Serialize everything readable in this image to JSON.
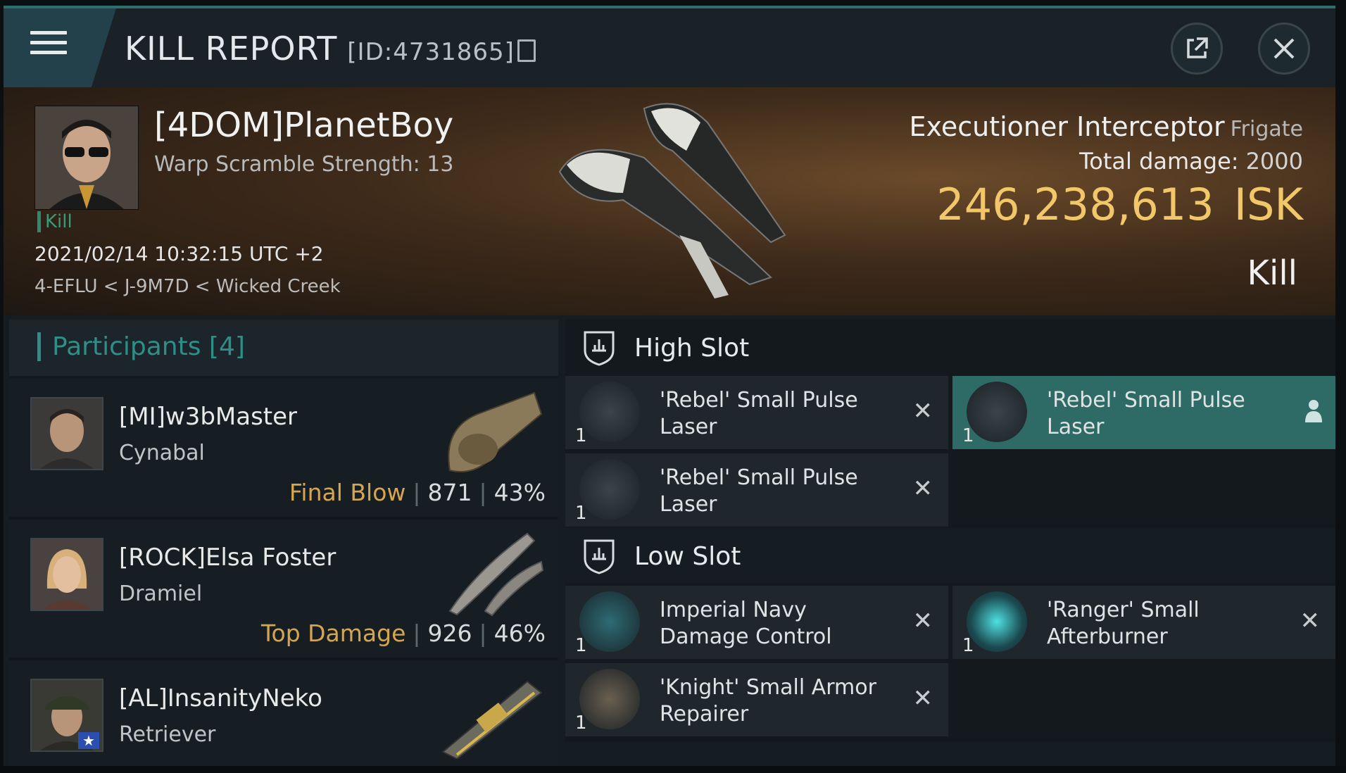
{
  "header": {
    "title": "KILL REPORT",
    "id_label": "[ID:4731865]"
  },
  "victim": {
    "name": "[4DOM]PlanetBoy",
    "warp_scramble": "Warp Scramble Strength: 13",
    "tag": "Kill",
    "datetime": "2021/02/14 10:32:15 UTC +2",
    "location": "4-EFLU < J-9M7D < Wicked Creek"
  },
  "ship": {
    "name": "Executioner Interceptor",
    "class": "Frigate",
    "total_damage_label": "Total damage:",
    "total_damage": "2000",
    "isk_value": "246,238,613",
    "isk_unit": "ISK",
    "result": "Kill"
  },
  "participants": {
    "title": "Participants [4]",
    "rows": [
      {
        "name": "[MI]w3bMaster",
        "ship": "Cynabal",
        "role": "Final Blow",
        "damage": "871",
        "percent": "43%"
      },
      {
        "name": "[ROCK]Elsa Foster",
        "ship": "Dramiel",
        "role": "Top Damage",
        "damage": "926",
        "percent": "46%"
      },
      {
        "name": "[AL]InsanityNeko",
        "ship": "Retriever",
        "role": "",
        "damage": "",
        "percent": ""
      }
    ]
  },
  "fitting": {
    "high_slot": {
      "title": "High Slot",
      "modules": [
        {
          "qty": "1",
          "name": "'Rebel' Small Pulse Laser",
          "state": "destroyed"
        },
        {
          "qty": "1",
          "name": "'Rebel' Small Pulse Laser",
          "state": "dropped"
        },
        {
          "qty": "1",
          "name": "'Rebel' Small Pulse Laser",
          "state": "destroyed"
        }
      ]
    },
    "low_slot": {
      "title": "Low Slot",
      "modules": [
        {
          "qty": "1",
          "name": "Imperial Navy Damage Control",
          "state": "destroyed"
        },
        {
          "qty": "1",
          "name": "'Ranger' Small Afterburner",
          "state": "destroyed"
        },
        {
          "qty": "1",
          "name": "'Knight' Small Armor Repairer",
          "state": "destroyed"
        }
      ]
    }
  },
  "colors": {
    "accent_teal": "#2f8f86",
    "isk_gold": "#f1c76a",
    "highlight_row": "#2f6b66",
    "role_gold": "#d6a64e"
  },
  "icons": {
    "menu": "hamburger-icon",
    "external": "external-link-icon",
    "close": "close-icon",
    "copy": "copy-icon",
    "slot": "shield-slot-icon",
    "destroyed": "x-icon",
    "dropped": "person-icon"
  }
}
